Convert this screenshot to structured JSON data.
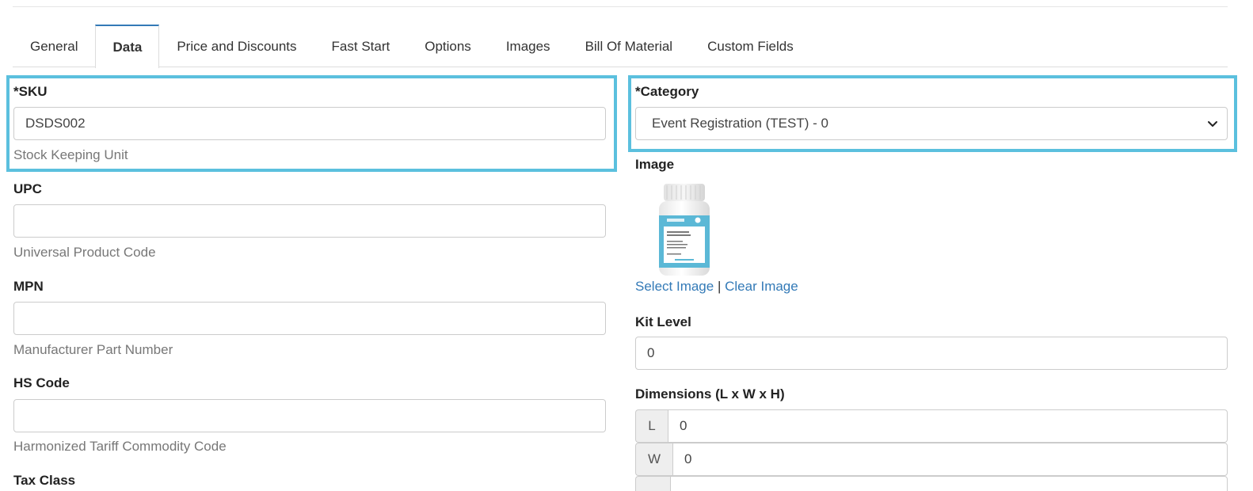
{
  "tabs": [
    "General",
    "Data",
    "Price and Discounts",
    "Fast Start",
    "Options",
    "Images",
    "Bill Of Material",
    "Custom Fields"
  ],
  "active_tab": "Data",
  "left": {
    "sku": {
      "label": "*SKU",
      "value": "DSDS002",
      "help": "Stock Keeping Unit"
    },
    "upc": {
      "label": "UPC",
      "value": "",
      "help": "Universal Product Code"
    },
    "mpn": {
      "label": "MPN",
      "value": "",
      "help": "Manufacturer Part Number"
    },
    "hs_code": {
      "label": "HS Code",
      "value": "",
      "help": "Harmonized Tariff Commodity Code"
    },
    "tax_class": {
      "label": "Tax Class"
    }
  },
  "right": {
    "category": {
      "label": "*Category",
      "value": "Event Registration (TEST) - 0"
    },
    "image": {
      "label": "Image",
      "select_link": "Select Image",
      "separator": "|",
      "clear_link": "Clear Image"
    },
    "kit_level": {
      "label": "Kit Level",
      "value": "0"
    },
    "dimensions": {
      "label": "Dimensions (L x W x H)",
      "l_label": "L",
      "l_value": "0",
      "w_label": "W",
      "w_value": "0"
    }
  },
  "colors": {
    "highlight": "#5bc0de",
    "link": "#337ab7",
    "tab_accent": "#337ab7"
  },
  "icons": {
    "select_arrow": "chevron-down-icon",
    "product": "supplement-bottle-image"
  }
}
